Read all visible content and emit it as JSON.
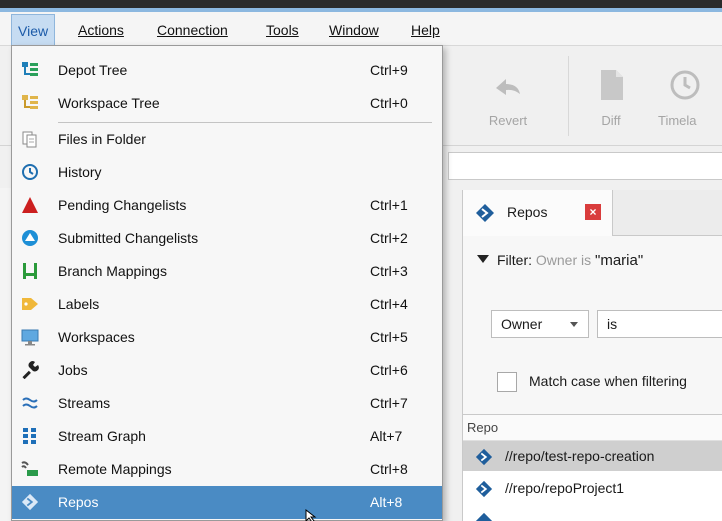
{
  "menubar": {
    "items": [
      {
        "label": "View"
      },
      {
        "label": "Actions"
      },
      {
        "label": "Connection"
      },
      {
        "label": "Tools"
      },
      {
        "label": "Window"
      },
      {
        "label": "Help"
      }
    ]
  },
  "toolbar": {
    "revert_label": "Revert",
    "diff_label": "Diff",
    "timelapse_label": "Timela"
  },
  "view_menu": {
    "items": [
      {
        "label": "Depot Tree",
        "shortcut": "Ctrl+9",
        "icon": "depot-tree-icon"
      },
      {
        "label": "Workspace Tree",
        "shortcut": "Ctrl+0",
        "icon": "workspace-tree-icon"
      },
      {
        "label": "Files in Folder",
        "shortcut": "",
        "icon": "files-in-folder-icon"
      },
      {
        "label": "History",
        "shortcut": "",
        "icon": "history-icon"
      },
      {
        "label": "Pending Changelists",
        "shortcut": "Ctrl+1",
        "icon": "pending-changelists-icon"
      },
      {
        "label": "Submitted Changelists",
        "shortcut": "Ctrl+2",
        "icon": "submitted-changelists-icon"
      },
      {
        "label": "Branch Mappings",
        "shortcut": "Ctrl+3",
        "icon": "branch-mappings-icon"
      },
      {
        "label": "Labels",
        "shortcut": "Ctrl+4",
        "icon": "labels-icon"
      },
      {
        "label": "Workspaces",
        "shortcut": "Ctrl+5",
        "icon": "workspaces-icon"
      },
      {
        "label": "Jobs",
        "shortcut": "Ctrl+6",
        "icon": "jobs-icon"
      },
      {
        "label": "Streams",
        "shortcut": "Ctrl+7",
        "icon": "streams-icon"
      },
      {
        "label": "Stream Graph",
        "shortcut": "Alt+7",
        "icon": "stream-graph-icon"
      },
      {
        "label": "Remote Mappings",
        "shortcut": "Ctrl+8",
        "icon": "remote-mappings-icon"
      },
      {
        "label": "Repos",
        "shortcut": "Alt+8",
        "icon": "repos-icon"
      }
    ]
  },
  "repos_panel": {
    "tab_label": "Repos",
    "filter_label": "Filter:",
    "filter_condition": "Owner is",
    "filter_value": "\"maria\"",
    "field_select": "Owner",
    "operator_select": "is",
    "match_case_label": "Match case when filtering",
    "column_header": "Repo",
    "rows": [
      {
        "name": "//repo/test-repo-creation",
        "selected": true
      },
      {
        "name": "//repo/repoProject1",
        "selected": false
      }
    ]
  },
  "colors": {
    "highlight": "#4a8bc4",
    "active_menu_bg": "#c6dcf2",
    "repo_icon": "#1f5e9c",
    "close_badge": "#d93c3c"
  }
}
